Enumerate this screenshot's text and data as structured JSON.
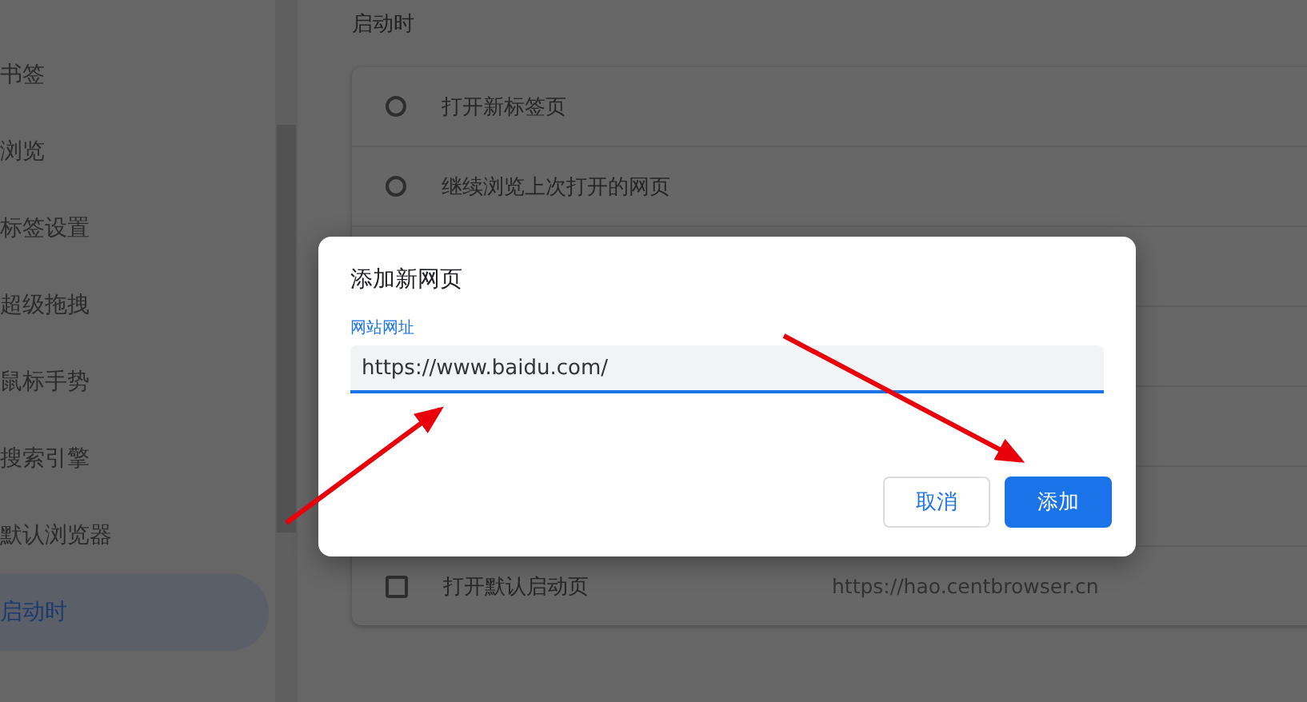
{
  "sidebar": {
    "items": [
      {
        "label": "书签",
        "selected": false
      },
      {
        "label": "浏览",
        "selected": false
      },
      {
        "label": "标签设置",
        "selected": false
      },
      {
        "label": "超级拖拽",
        "selected": false
      },
      {
        "label": "鼠标手势",
        "selected": false
      },
      {
        "label": "搜索引擎",
        "selected": false
      },
      {
        "label": "默认浏览器",
        "selected": false
      },
      {
        "label": "启动时",
        "selected": true
      }
    ]
  },
  "startup": {
    "heading": "启动时",
    "options": [
      {
        "kind": "radio",
        "label": "打开新标签页",
        "selected": false
      },
      {
        "kind": "radio",
        "label": "继续浏览上次打开的网页",
        "selected": false
      },
      {
        "kind": "checkbox",
        "label": "打开默认启动页",
        "checked": false,
        "url": "https://hao.centbrowser.cn"
      }
    ]
  },
  "dialog": {
    "title": "添加新网页",
    "field": {
      "label": "网站网址",
      "value": "https://www.baidu.com/"
    },
    "buttons": [
      {
        "label": "取消",
        "kind": "secondary"
      },
      {
        "label": "添加",
        "kind": "primary"
      }
    ]
  }
}
